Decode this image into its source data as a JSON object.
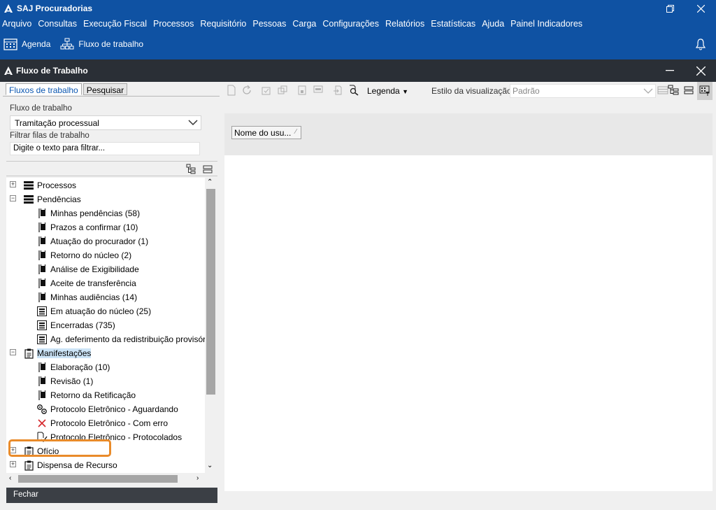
{
  "app": {
    "title": "SAJ Procuradorias",
    "window_controls": [
      "restore-icon",
      "close-icon"
    ]
  },
  "menu": [
    "Arquivo",
    "Consultas",
    "Execução Fiscal",
    "Processos",
    "Requisitório",
    "Pessoas",
    "Carga",
    "Configurações",
    "Relatórios",
    "Estatísticas",
    "Ajuda",
    "Painel Indicadores"
  ],
  "quickbar": {
    "agenda": "Agenda",
    "fluxo": "Fluxo de trabalho"
  },
  "window": {
    "title": "Fluxo de Trabalho"
  },
  "left": {
    "tabs": [
      "Fluxos de trabalho",
      "Pesquisar"
    ],
    "workflow_label": "Fluxo de trabalho",
    "workflow_value": "Tramitação processual",
    "filter_label": "Filtrar filas de trabalho",
    "filter_placeholder": "Digite o texto para filtrar...",
    "close_label": "Fechar"
  },
  "tree": [
    {
      "label": "Processos",
      "level": 0,
      "icon": "list-icon",
      "expander": "+"
    },
    {
      "label": "Pendências",
      "level": 0,
      "icon": "list-icon",
      "expander": "-"
    },
    {
      "label": "Minhas pendências (58)",
      "level": 1,
      "icon": "flag-icon"
    },
    {
      "label": "Prazos a confirmar (10)",
      "level": 1,
      "icon": "flag-icon"
    },
    {
      "label": "Atuação do procurador (1)",
      "level": 1,
      "icon": "flag-icon"
    },
    {
      "label": "Retorno do núcleo (2)",
      "level": 1,
      "icon": "flag-icon"
    },
    {
      "label": "Análise de Exigibilidade",
      "level": 1,
      "icon": "flag-icon"
    },
    {
      "label": "Aceite de transferência",
      "level": 1,
      "icon": "flag-icon"
    },
    {
      "label": "Minhas audiências (14)",
      "level": 1,
      "icon": "flag-icon"
    },
    {
      "label": "Em atuação do núcleo (25)",
      "level": 1,
      "icon": "grid-icon"
    },
    {
      "label": "Encerradas (735)",
      "level": 1,
      "icon": "grid-icon"
    },
    {
      "label": "Ag. deferimento da redistribuição provisória",
      "level": 1,
      "icon": "grid-icon"
    },
    {
      "label": "Manifestações",
      "level": 0,
      "icon": "document-icon",
      "expander": "-",
      "selected": true
    },
    {
      "label": "Elaboração (10)",
      "level": 1,
      "icon": "flag-icon"
    },
    {
      "label": "Revisão (1)",
      "level": 1,
      "icon": "flag-icon"
    },
    {
      "label": "Retorno da Retificação",
      "level": 1,
      "icon": "flag-icon"
    },
    {
      "label": "Protocolo Eletrônico - Aguardando",
      "level": 1,
      "icon": "gears-icon"
    },
    {
      "label": "Protocolo Eletrônico - Com erro",
      "level": 1,
      "icon": "error-x-icon"
    },
    {
      "label": "Protocolo Eletrônico - Protocolados",
      "level": 1,
      "icon": "doc-check-icon"
    },
    {
      "label": "Ofício",
      "level": 0,
      "icon": "document-icon",
      "expander": "+"
    },
    {
      "label": "Dispensa de Recurso",
      "level": 0,
      "icon": "document-icon",
      "expander": "+"
    }
  ],
  "right": {
    "legenda": "Legenda",
    "estilo_label": "Estilo da visualização",
    "estilo_value": "Padrão",
    "column_header": "Nome do usu..."
  }
}
